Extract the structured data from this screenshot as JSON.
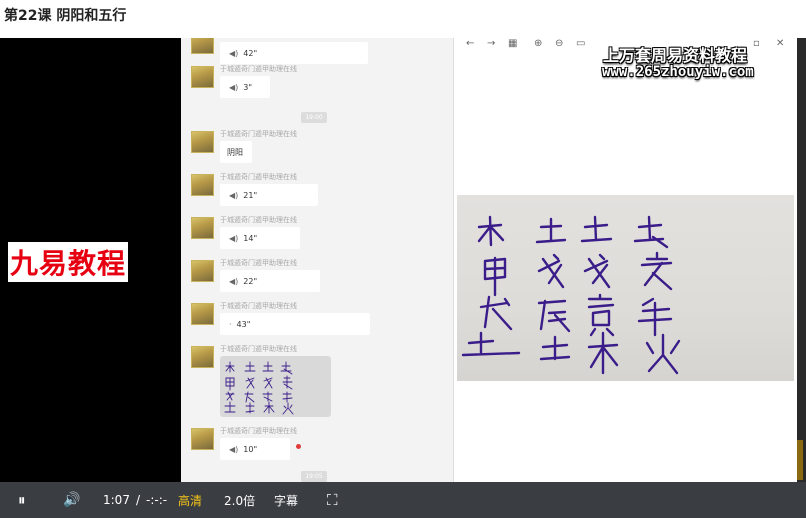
{
  "page": {
    "title": "第22课 阴阳和五行"
  },
  "watermark": {
    "text": "九易教程"
  },
  "chat": {
    "sender_name": "于城遁奇门遁甲助理在线",
    "timestamps": [
      "19:00",
      "19:05"
    ],
    "messages": [
      {
        "type": "voice",
        "duration": "42\""
      },
      {
        "type": "voice",
        "duration": "3\""
      },
      {
        "type": "text",
        "text": "阴阳"
      },
      {
        "type": "voice",
        "duration": "21\""
      },
      {
        "type": "voice",
        "duration": "14\""
      },
      {
        "type": "voice",
        "duration": "22\""
      },
      {
        "type": "voice",
        "duration": "43\""
      },
      {
        "type": "image"
      },
      {
        "type": "voice",
        "duration": "10\"",
        "unread": true
      }
    ]
  },
  "doc_viewer": {
    "toolbar": {
      "back_icon": "←",
      "forward_icon": "→",
      "grid_icon": "▦",
      "zoom_in_icon": "⊕",
      "zoom_out_icon": "⊖",
      "fit_icon": "▭",
      "restore_icon": "▫",
      "close_icon": "✕"
    },
    "overlay_title": "上万套周易资料教程",
    "overlay_url": "www.265zhouyiw.com"
  },
  "controls": {
    "pause_icon": "⏸",
    "volume_icon": "🔊",
    "current_time": "1:07",
    "separator": "/",
    "total_time": "-:-:-",
    "quality_label": "高清",
    "speed_label": "2.0倍",
    "subtitle_label": "字幕",
    "fullscreen_icon": "⛶"
  },
  "colors": {
    "quality_active": "#f5c518",
    "player_bg": "#000000",
    "control_bar": "#3a3d42",
    "ink": "#3a1d8a"
  }
}
